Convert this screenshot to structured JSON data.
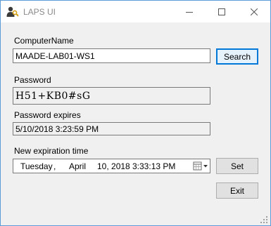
{
  "window": {
    "title": "LAPS UI",
    "icon": "laps-user-key-icon",
    "controls": [
      "minimize-icon",
      "maximize-icon",
      "close-icon"
    ]
  },
  "computer": {
    "label": "ComputerName",
    "value": "MAADE-LAB01-WS1",
    "search_label": "Search"
  },
  "password": {
    "label": "Password",
    "value": "H51+KB0#sG"
  },
  "expires": {
    "label": "Password expires",
    "value": "5/10/2018 3:23:59 PM"
  },
  "new_expiration": {
    "label": "New expiration time",
    "weekday": "Tuesday",
    "separator": ",",
    "month": "April",
    "day_year": "10, 2018",
    "time": "3:33:13 PM",
    "dropdown_icon": "calendar-dropdown-icon",
    "set_label": "Set"
  },
  "exit_label": "Exit"
}
